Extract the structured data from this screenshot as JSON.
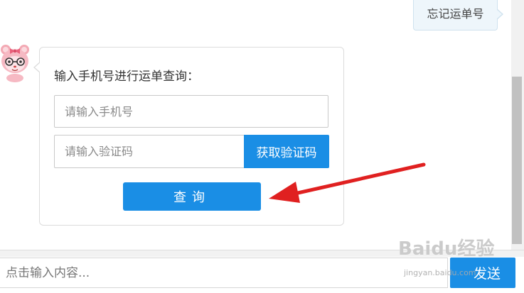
{
  "chat": {
    "user_message": "忘记运单号",
    "bot_card": {
      "title": "输入手机号进行运单查询：",
      "phone_placeholder": "请输入手机号",
      "code_placeholder": "请输入验证码",
      "get_code_label": "获取验证码",
      "query_label": "查询"
    }
  },
  "composer": {
    "placeholder": "点击输入内容...",
    "send_label": "发送"
  },
  "watermark": {
    "logo": "Baidu经验",
    "url": "jingyan.baidu.com"
  },
  "colors": {
    "accent": "#1a8ee5",
    "arrow": "#e02020",
    "user_bubble": "#eef6fb"
  }
}
